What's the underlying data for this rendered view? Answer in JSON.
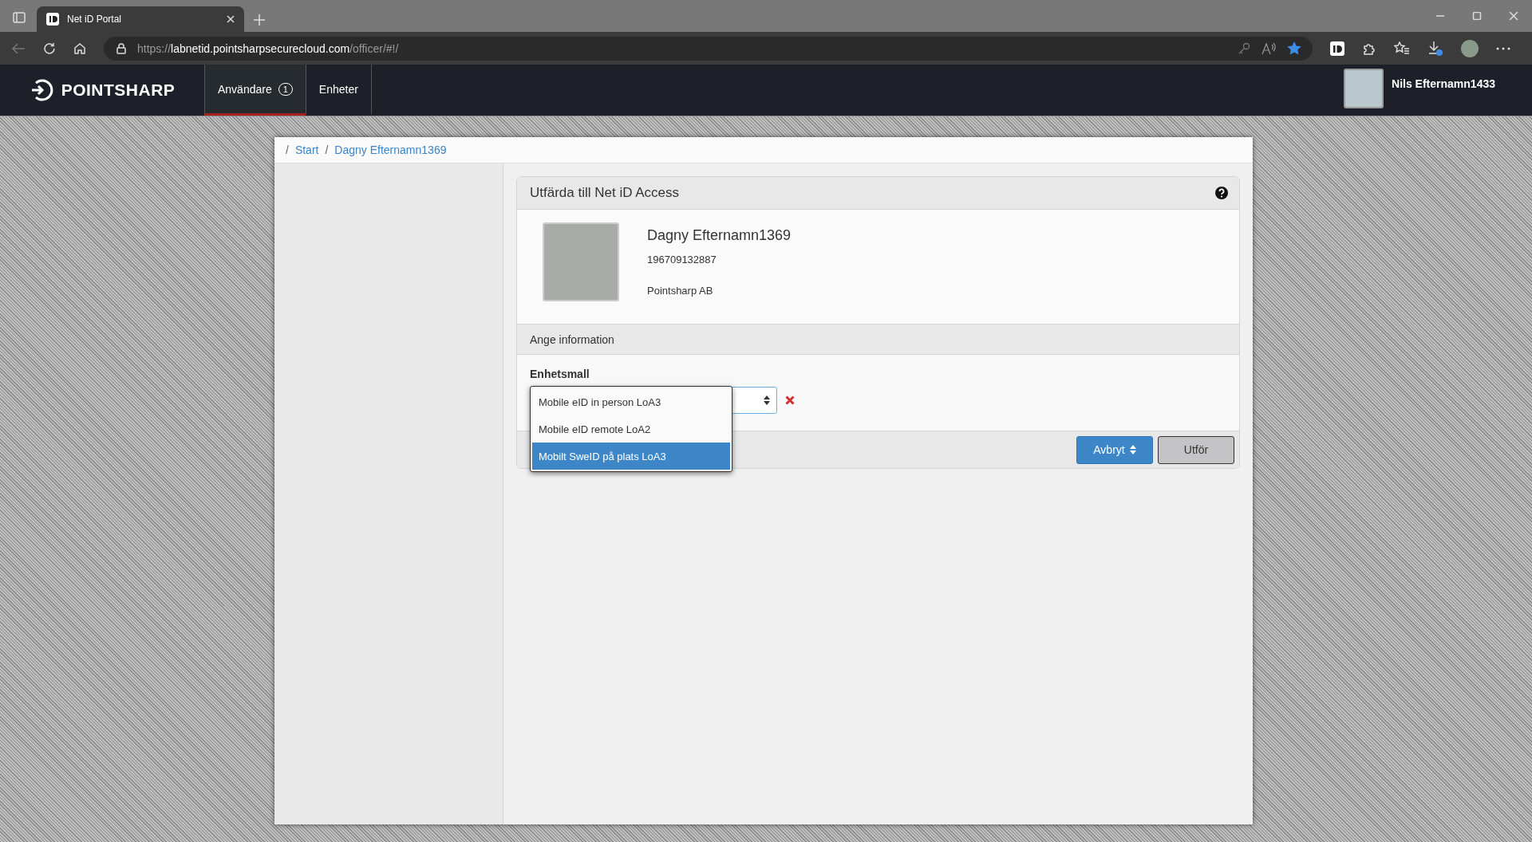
{
  "browser": {
    "tab_title": "Net iD Portal",
    "url": {
      "scheme": "https://",
      "host": "labnetid.pointsharpsecurecloud.com",
      "path": "/officer/#!/"
    }
  },
  "app_nav": {
    "logo": "POINTSHARP",
    "tabs": [
      {
        "label": "Användare",
        "badge": "1",
        "selected": true
      },
      {
        "label": "Enheter",
        "selected": false
      }
    ],
    "user_name": "Nils Efternamn1433"
  },
  "breadcrumb": [
    {
      "separator": "/",
      "label": "Start"
    },
    {
      "separator": "/",
      "label": "Dagny Efternamn1369"
    }
  ],
  "panel": {
    "title": "Utfärda till Net iD Access",
    "person": {
      "name": "Dagny Efternamn1369",
      "id_number": "196709132887",
      "organization": "Pointsharp AB"
    },
    "section_title": "Ange information",
    "field": {
      "label": "Enhetsmall",
      "options": [
        {
          "label": "Mobile eID in person LoA3",
          "selected": false
        },
        {
          "label": "Mobile eID remote LoA2",
          "selected": false
        },
        {
          "label": "Mobilt SweID på plats LoA3",
          "selected": true
        }
      ]
    },
    "buttons": [
      {
        "label": "Avbryt",
        "kind": "primary"
      },
      {
        "label": "Utför",
        "kind": "secondary"
      }
    ]
  }
}
